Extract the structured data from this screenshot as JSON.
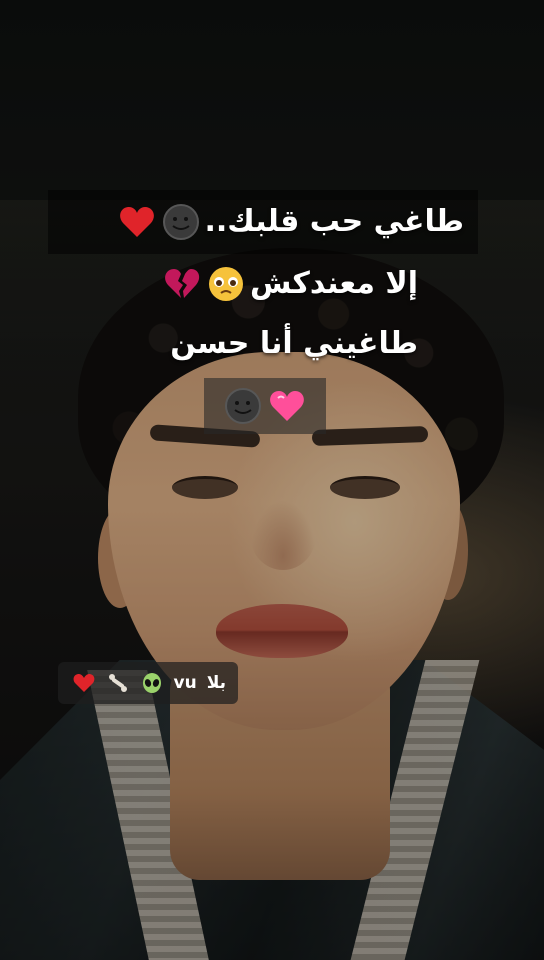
{
  "caption": {
    "line1": "طاغي حب قلبك..",
    "line2": "إلا معندكش",
    "line3": "طاغيني أنا حسن"
  },
  "emojis": {
    "line1": [
      "smiling-moon-face-icon",
      "red-heart-icon"
    ],
    "line2": [
      "pleading-face-icon",
      "broken-heart-icon"
    ],
    "line4": [
      "smiling-moon-face-icon",
      "pink-heart-icon"
    ]
  },
  "tag": {
    "label": "بلا",
    "handle": "vu",
    "emojis": [
      "alien-icon",
      "bone-icon",
      "red-heart-icon"
    ]
  },
  "colors": {
    "caption_bg": "#000000",
    "text": "#ffffff",
    "heart_red": "#e0242a",
    "heart_pink": "#ff4f9a"
  }
}
